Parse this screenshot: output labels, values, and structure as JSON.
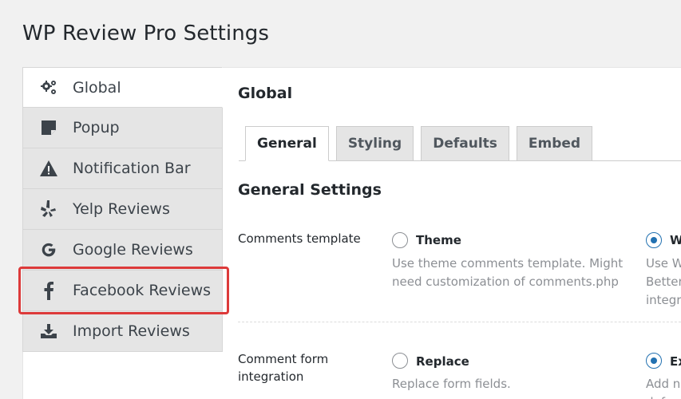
{
  "page": {
    "title": "WP Review Pro Settings"
  },
  "sidebar": {
    "items": [
      {
        "label": "Global",
        "icon": "gears-icon",
        "active": true
      },
      {
        "label": "Popup",
        "icon": "sticky-note-icon"
      },
      {
        "label": "Notification Bar",
        "icon": "warning-icon"
      },
      {
        "label": "Yelp Reviews",
        "icon": "yelp-icon"
      },
      {
        "label": "Google Reviews",
        "icon": "google-icon"
      },
      {
        "label": "Facebook Reviews",
        "icon": "facebook-icon",
        "highlighted": true
      },
      {
        "label": "Import Reviews",
        "icon": "download-icon"
      }
    ]
  },
  "main": {
    "title": "Global",
    "tabs": [
      {
        "label": "General",
        "active": true
      },
      {
        "label": "Styling"
      },
      {
        "label": "Defaults"
      },
      {
        "label": "Embed"
      }
    ],
    "section_title": "General Settings",
    "rows": [
      {
        "label": "Comments template",
        "options": [
          {
            "label": "Theme",
            "desc": [
              "Use theme comments template. Might",
              "need customization of comments.php"
            ],
            "checked": false
          },
          {
            "label": "W",
            "desc": [
              "Use W",
              "Better",
              "integr"
            ],
            "checked": true
          }
        ]
      },
      {
        "label": "Comment form integration",
        "label_lines": [
          "Comment form",
          "integration"
        ],
        "options": [
          {
            "label": "Replace",
            "desc": [
              "Replace form fields."
            ],
            "checked": false
          },
          {
            "label": "Ex",
            "desc": [
              "Add n",
              "defa"
            ],
            "checked": true
          }
        ]
      }
    ]
  },
  "colors": {
    "highlight": "#dd3a3a",
    "radio_checked": "#2271b1"
  }
}
